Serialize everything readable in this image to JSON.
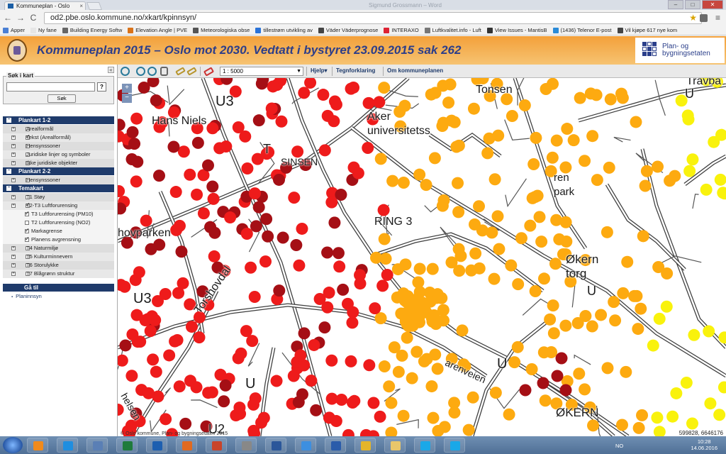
{
  "browser": {
    "tab_title": "Kommuneplan - Oslo",
    "tab_close": "×",
    "window_title": "Sigmund Grossmann – Word",
    "url": "od2.pbe.oslo.kommune.no/xkart/kpinnsyn/",
    "star": "★",
    "menu": "≡",
    "back": "←",
    "forward": "→",
    "reload": "C",
    "min": "–",
    "max": "□",
    "close": "✕",
    "bookmarks": [
      "Apper",
      "Ny fane",
      "Building Energy Softw",
      "Elevation Angle | PVE",
      "Meteorologiska obse",
      "tillestrøm utvikling av",
      "Väder Väderprognose",
      "INTERAXO",
      "Luftkvalitet.info - Luft",
      "View Issues - MantisB",
      "(1436) Telenor E-post",
      "Vil kjøpe 617 nye kom"
    ]
  },
  "header": {
    "title": "Kommuneplan 2015 – Oslo mot 2030. Vedtatt i bystyret 23.09.2015 sak 262",
    "agency": "Plan- og bygningsetaten"
  },
  "sidebar": {
    "collapse": "«",
    "search_legend": "Søk i kart",
    "search_help": "?",
    "search_button": "Søk",
    "sections": [
      {
        "title": "Plankart 1-2",
        "items": [
          {
            "label": "Arealformål",
            "checked": false
          },
          {
            "label": "Tekst (Arealformål)",
            "checked": true
          },
          {
            "label": "Hensynssoner",
            "checked": false
          },
          {
            "label": "Juridiske linjer og symboler",
            "checked": false
          },
          {
            "label": "Ikke juridiske objekter",
            "checked": false
          }
        ]
      },
      {
        "title": "Plankart 2-2",
        "items": [
          {
            "label": "Hensynssoner",
            "checked": false
          }
        ]
      },
      {
        "title": "Temakart",
        "items": [
          {
            "label": "T1 Støy",
            "checked": false
          },
          {
            "label": "T2-T3 Luftforurensing",
            "checked": true
          },
          {
            "label": "T3 Luftforurensing (PM10)",
            "checked": true,
            "sub": true
          },
          {
            "label": "T2 Luftforurensing (NO2)",
            "checked": false,
            "sub": true
          },
          {
            "label": "Markagrense",
            "checked": true,
            "sub": true
          },
          {
            "label": "Planens avgrensning",
            "checked": true,
            "sub": true
          },
          {
            "label": "T4 Naturmiljø",
            "checked": false
          },
          {
            "label": "T5 Kulturminnevern",
            "checked": false
          },
          {
            "label": "T6 Storulykke",
            "checked": false
          },
          {
            "label": "T7 Blågrønn struktur",
            "checked": false
          }
        ]
      }
    ],
    "goto_title": "Gå til",
    "goto_link": "Planinnsyn"
  },
  "map_toolbar": {
    "scale": "1 : 5000",
    "scale_arrow": "▼",
    "help": "Hjelp▾",
    "legend": "Tegnforklaring",
    "about": "Om kommuneplanen"
  },
  "map": {
    "zoom_in": "+",
    "zoom_out": "−",
    "labels": [
      {
        "text": "U3",
        "cls": "big"
      },
      {
        "text": "Hans Niels"
      },
      {
        "text": "T"
      },
      {
        "text": "SINSEN"
      },
      {
        "text": "Aker"
      },
      {
        "text": "universitetss"
      },
      {
        "text": "Tonsen"
      },
      {
        "text": "Travba"
      },
      {
        "text": "U"
      },
      {
        "text": "ren"
      },
      {
        "text": "park"
      },
      {
        "text": "RING 3"
      },
      {
        "text": "hovparken"
      },
      {
        "text": "Økern"
      },
      {
        "text": "torg"
      },
      {
        "text": "U"
      },
      {
        "text": "U3"
      },
      {
        "text": "Torshovdal"
      },
      {
        "text": "U"
      },
      {
        "text": "arenveien"
      },
      {
        "text": "U"
      },
      {
        "text": "ØKERN"
      },
      {
        "text": "U2"
      },
      {
        "text": "helsen"
      }
    ],
    "coords": "599828, 6646176",
    "copyright": "© Oslo kommune, Plan- og bygningsetaten 2015",
    "colors": {
      "dark_red": "#a50f15",
      "red": "#ee1b1b",
      "orange": "#fdaa10",
      "yellow": "#f9f20c",
      "road": "#3c3c3c"
    }
  },
  "taskbar": {
    "lang": "NO",
    "time": "10:28",
    "date": "14.06.2016"
  }
}
